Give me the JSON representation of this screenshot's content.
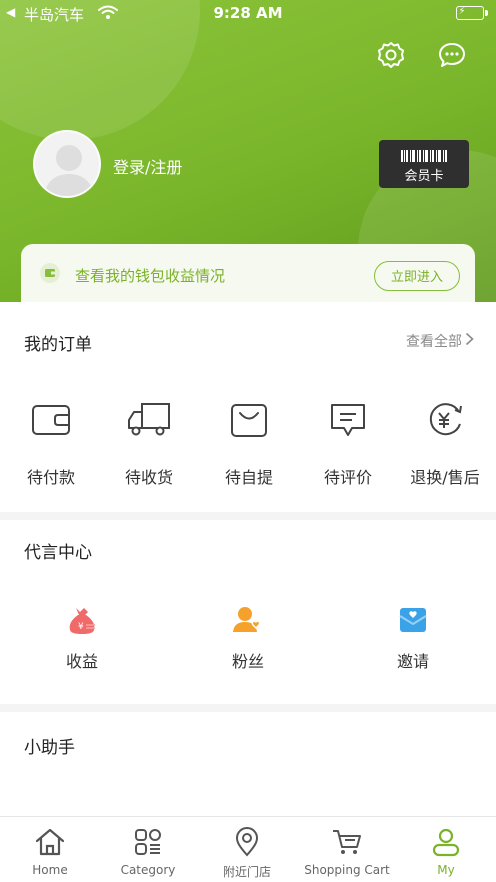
{
  "status_bar": {
    "back_glyph": "◀",
    "carrier": "半岛汽车",
    "time": "9:28 AM",
    "battery_state": "charging"
  },
  "profile": {
    "login_label": "登录/注册",
    "member_card_label": "会员卡"
  },
  "wallet": {
    "text": "查看我的钱包收益情况",
    "button_label": "立即进入"
  },
  "orders": {
    "title": "我的订单",
    "view_all_label": "查看全部",
    "items": [
      {
        "label": "待付款",
        "icon": "wallet-icon"
      },
      {
        "label": "待收货",
        "icon": "truck-icon"
      },
      {
        "label": "待自提",
        "icon": "bag-icon"
      },
      {
        "label": "待评价",
        "icon": "comment-icon"
      },
      {
        "label": "退换/售后",
        "icon": "refund-icon"
      }
    ]
  },
  "agent_center": {
    "title": "代言中心",
    "items": [
      {
        "label": "收益",
        "icon": "money-bag-icon"
      },
      {
        "label": "粉丝",
        "icon": "fans-icon"
      },
      {
        "label": "邀请",
        "icon": "invite-icon"
      }
    ]
  },
  "helper": {
    "title": "小助手"
  },
  "tabbar": {
    "items": [
      {
        "label": "Home",
        "icon": "home-icon"
      },
      {
        "label": "Category",
        "icon": "category-icon"
      },
      {
        "label": "附近门店",
        "icon": "location-icon"
      },
      {
        "label": "Shopping Cart",
        "icon": "cart-icon"
      },
      {
        "label": "My",
        "icon": "user-icon"
      }
    ],
    "active_index": 4
  },
  "colors": {
    "brand_green": "#7ab22a",
    "header_gradient_start": "#8cc43a",
    "header_gradient_end": "#5f9a1c",
    "money_bag": "#f06a6a",
    "fans": "#f5a12b",
    "invite": "#3aa3e8"
  }
}
